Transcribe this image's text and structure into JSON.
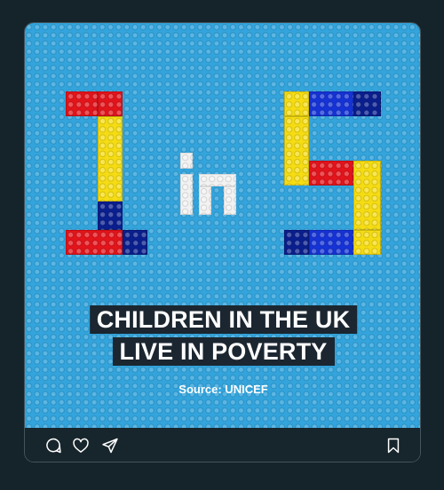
{
  "graphic": {
    "number_left": "1",
    "word": "in",
    "number_right": "5"
  },
  "caption": {
    "line1": "CHILDREN IN THE UK",
    "line2": "LIVE IN POVERTY"
  },
  "source": "Source: UNICEF",
  "colors": {
    "background": "#15232a",
    "baseplate": "#33a4dc",
    "red": "#e3141b",
    "yellow": "#f5dc13",
    "navy": "#0a1f8f",
    "white": "#f2f2f2",
    "caption_bg": "#1b2630"
  },
  "actions": {
    "comment_icon": "comment-icon",
    "like_icon": "heart-icon",
    "share_icon": "send-icon",
    "save_icon": "bookmark-icon"
  }
}
